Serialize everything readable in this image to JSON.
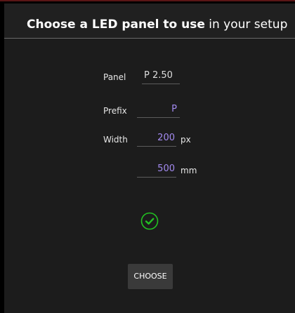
{
  "window": {
    "title_bold": "Choose a LED panel to use",
    "title_regular": " in your setup"
  },
  "form": {
    "panel_label": "Panel",
    "panel_value": "P 2.50",
    "prefix_label": "Prefix",
    "prefix_value": "P",
    "width_label": "Width",
    "width_px_value": "200",
    "width_px_unit": "px",
    "width_mm_value": "500",
    "width_mm_unit": "mm"
  },
  "status": {
    "icon": "check-circle-icon",
    "color": "#22c122"
  },
  "actions": {
    "choose_label": "CHOOSE"
  },
  "colors": {
    "value_accent": "#a38af0",
    "panel_value": "#dedede",
    "dialog_background": "#1c1c1c",
    "button_background": "#3a3a3a"
  }
}
